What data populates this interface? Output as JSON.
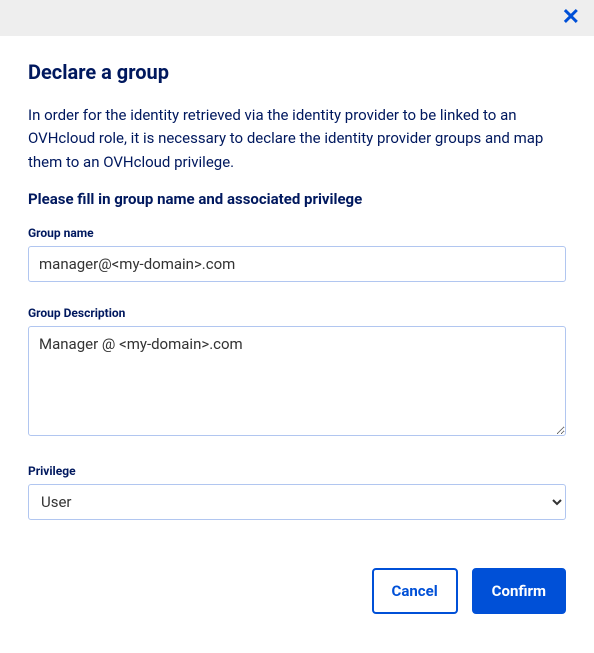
{
  "dialog": {
    "title": "Declare a group",
    "intro": "In order for the identity retrieved via the identity provider to be linked to an OVHcloud role, it is necessary to declare the identity provider groups and map them to an OVHcloud privilege.",
    "subtitle": "Please fill in group name and associated privilege"
  },
  "form": {
    "groupName": {
      "label": "Group name",
      "value": "manager@<my-domain>.com"
    },
    "groupDescription": {
      "label": "Group Description",
      "value": "Manager @ <my-domain>.com"
    },
    "privilege": {
      "label": "Privilege",
      "selected": "User"
    }
  },
  "buttons": {
    "cancel": "Cancel",
    "confirm": "Confirm"
  }
}
